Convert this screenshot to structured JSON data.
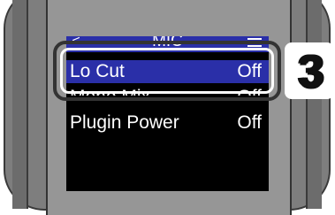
{
  "screen": {
    "title": "MIC",
    "back_glyph": "<",
    "items": [
      {
        "label": "Lo Cut",
        "value": "Off",
        "selected": true
      },
      {
        "label": "Mono Mix",
        "value": "Off",
        "selected": false
      },
      {
        "label": "Plugin Power",
        "value": "Off",
        "selected": false
      }
    ]
  },
  "callout": {
    "step_number": "3"
  },
  "colors": {
    "selection": "#2a2fa8",
    "screen_background": "#000000",
    "device_body": "#7e7e7e"
  }
}
